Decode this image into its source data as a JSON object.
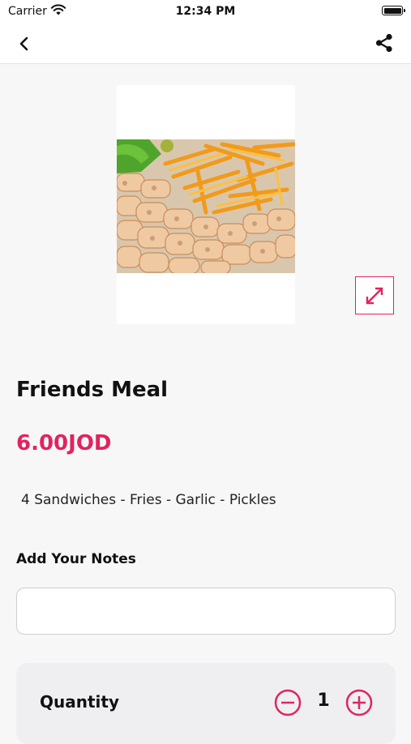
{
  "status_bar": {
    "carrier": "Carrier",
    "time": "12:34 PM"
  },
  "navbar": {
    "back_icon": "chevron-left-icon",
    "share_icon": "share-icon"
  },
  "product": {
    "image_icon": "food-photo",
    "expand_icon": "expand-arrows-icon",
    "name": "Friends Meal",
    "price": "6.00JOD",
    "description": "4 Sandwiches - Fries - Garlic - Pickles"
  },
  "notes": {
    "label": "Add Your Notes",
    "value": "",
    "placeholder": ""
  },
  "quantity": {
    "label": "Quantity",
    "value": "1",
    "minus_icon": "minus-circle-icon",
    "plus_icon": "plus-circle-icon"
  },
  "colors": {
    "accent": "#e0245e",
    "background": "#f7f7f8",
    "card": "#efeff2"
  }
}
